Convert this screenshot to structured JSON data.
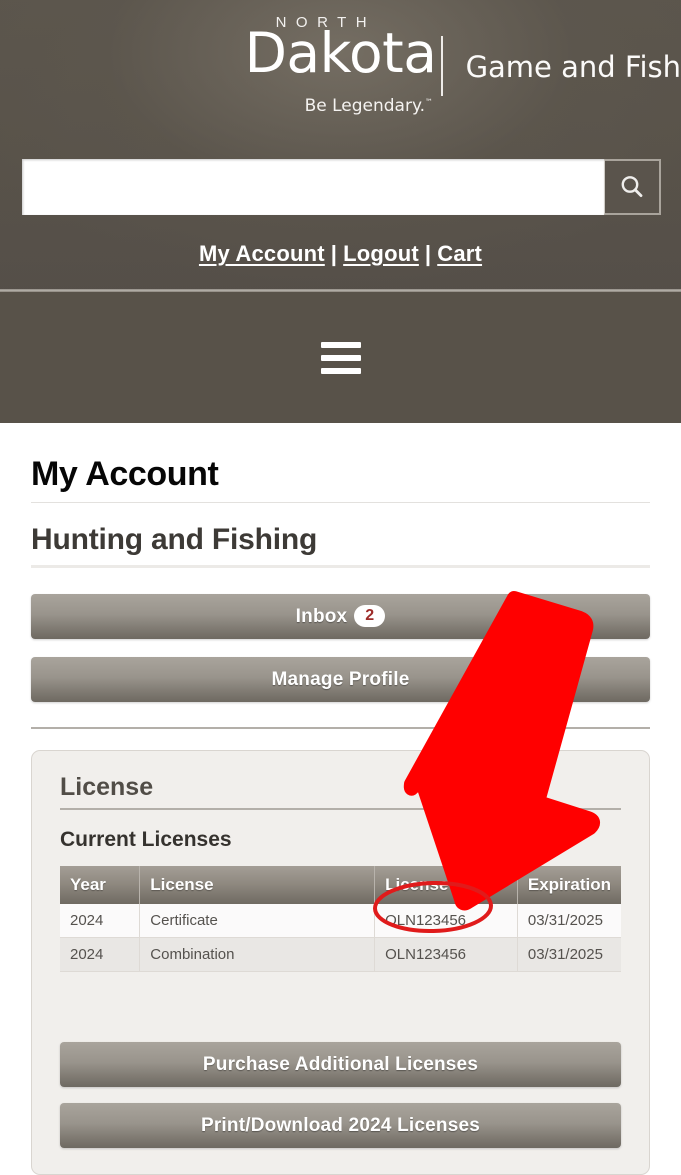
{
  "header": {
    "logo": {
      "north": "NORTH",
      "state": "Dakota",
      "agency": "Game and Fish",
      "tagline": "Be Legendary.",
      "trademark": "™"
    },
    "search": {
      "value": "",
      "placeholder": "",
      "button_icon": "search-icon"
    },
    "links": [
      {
        "label": "My Account"
      },
      {
        "label": "Logout"
      },
      {
        "label": "Cart"
      }
    ],
    "separator": "|"
  },
  "navbar": {
    "menu_icon": "hamburger-menu-icon"
  },
  "main": {
    "page_title": "My Account",
    "section_title": "Hunting and Fishing",
    "buttons": {
      "inbox_label": "Inbox",
      "inbox_count": "2",
      "manage_profile_label": "Manage Profile"
    },
    "license_card": {
      "title": "License",
      "subtitle": "Current Licenses",
      "table": {
        "columns": [
          "Year",
          "License",
          "License #",
          "Expiration"
        ],
        "rows": [
          {
            "year": "2024",
            "license": "Certificate",
            "number": "OLN123456",
            "expiration": "03/31/2025"
          },
          {
            "year": "2024",
            "license": "Combination",
            "number": "OLN123456",
            "expiration": "03/31/2025"
          }
        ]
      },
      "actions": {
        "purchase_label": "Purchase Additional Licenses",
        "print_label": "Print/Download 2024 Licenses"
      }
    }
  },
  "annotations": {
    "arrow_color": "#FF0000",
    "ellipse_color": "#E01B1B",
    "arrow_name": "red-arrow-annotation",
    "ellipse_name": "red-ellipse-annotation"
  },
  "colors": {
    "header_bg": "#585249",
    "button_gradient_top": "#a9a49c",
    "button_gradient_bottom": "#6e6961",
    "badge_text": "#9d2b29",
    "card_bg": "#f1efec"
  }
}
